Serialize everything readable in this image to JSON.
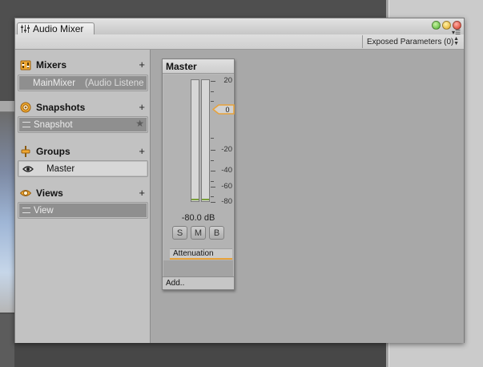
{
  "window": {
    "tab_title": "Audio Mixer",
    "exposed_params_label": "Exposed Parameters (0)"
  },
  "sidebar": {
    "mixers": {
      "title": "Mixers",
      "items": [
        {
          "name": "MainMixer",
          "output": "(Audio Listene"
        }
      ]
    },
    "snapshots": {
      "title": "Snapshots",
      "items": [
        {
          "name": "Snapshot",
          "starred": true
        }
      ]
    },
    "groups": {
      "title": "Groups",
      "items": [
        {
          "name": "Master"
        }
      ]
    },
    "views": {
      "title": "Views",
      "items": [
        {
          "name": "View"
        }
      ]
    },
    "add_glyph": "+"
  },
  "strip": {
    "name": "Master",
    "scale_labels": [
      "20",
      "-20",
      "-40",
      "-60",
      "-80"
    ],
    "fader_value": "0",
    "level_text": "-80.0 dB",
    "buttons": [
      "S",
      "M",
      "B"
    ],
    "effect": "Attenuation",
    "add_label": "Add.."
  },
  "colors": {
    "accent_orange": "#e8a23a",
    "meter_base_green": "#7aa03a"
  }
}
